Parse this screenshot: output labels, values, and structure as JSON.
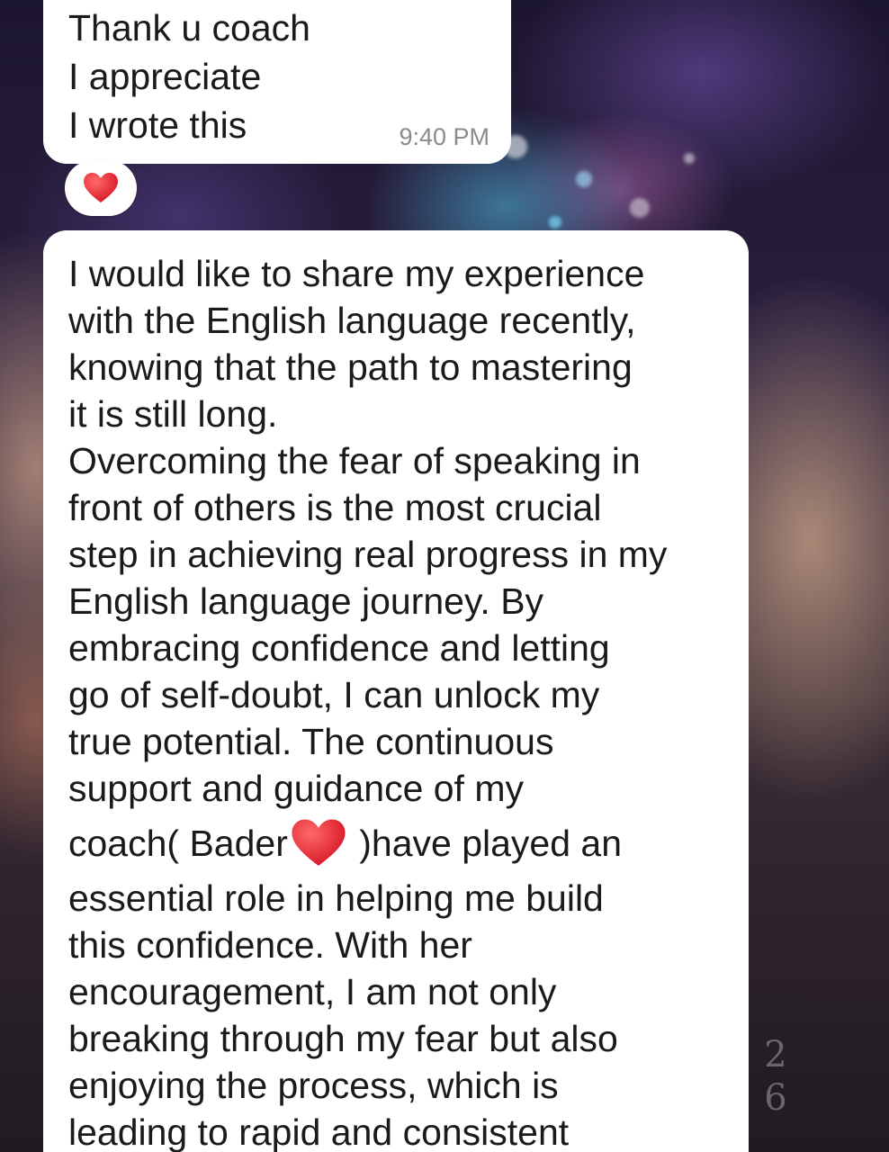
{
  "messages": {
    "incoming_short": {
      "lines": [
        "Thank u coach",
        "I appreciate",
        "I wrote this"
      ],
      "time": "9:40 PM",
      "reaction": "heart-emoji"
    },
    "incoming_long": {
      "lines": [
        "I would like to share my experience",
        "with the English language recently,",
        "knowing that the path to mastering",
        "it is still long.",
        "Overcoming the fear of speaking in",
        "front of others is the most crucial",
        "step in achieving real progress in my",
        "English language journey. By",
        "embracing confidence and letting",
        "go of self-doubt, I can unlock my",
        "true potential. The continuous",
        "support and guidance of my"
      ],
      "heart_line_before": "coach( Bader",
      "heart_line_after": " )have played an",
      "lines_after": [
        "essential role in helping me build",
        "this confidence. With her",
        "encouragement, I am not only",
        "breaking through my fear but also",
        "enjoying the process, which is",
        "leading to rapid and consistent"
      ]
    }
  },
  "wallpaper": {
    "side_digits": [
      "2",
      "6"
    ]
  },
  "colors": {
    "bubble": "#ffffff",
    "text": "#1a1a1a",
    "timestamp": "#8b8b8b",
    "heart": "#e8222e"
  }
}
